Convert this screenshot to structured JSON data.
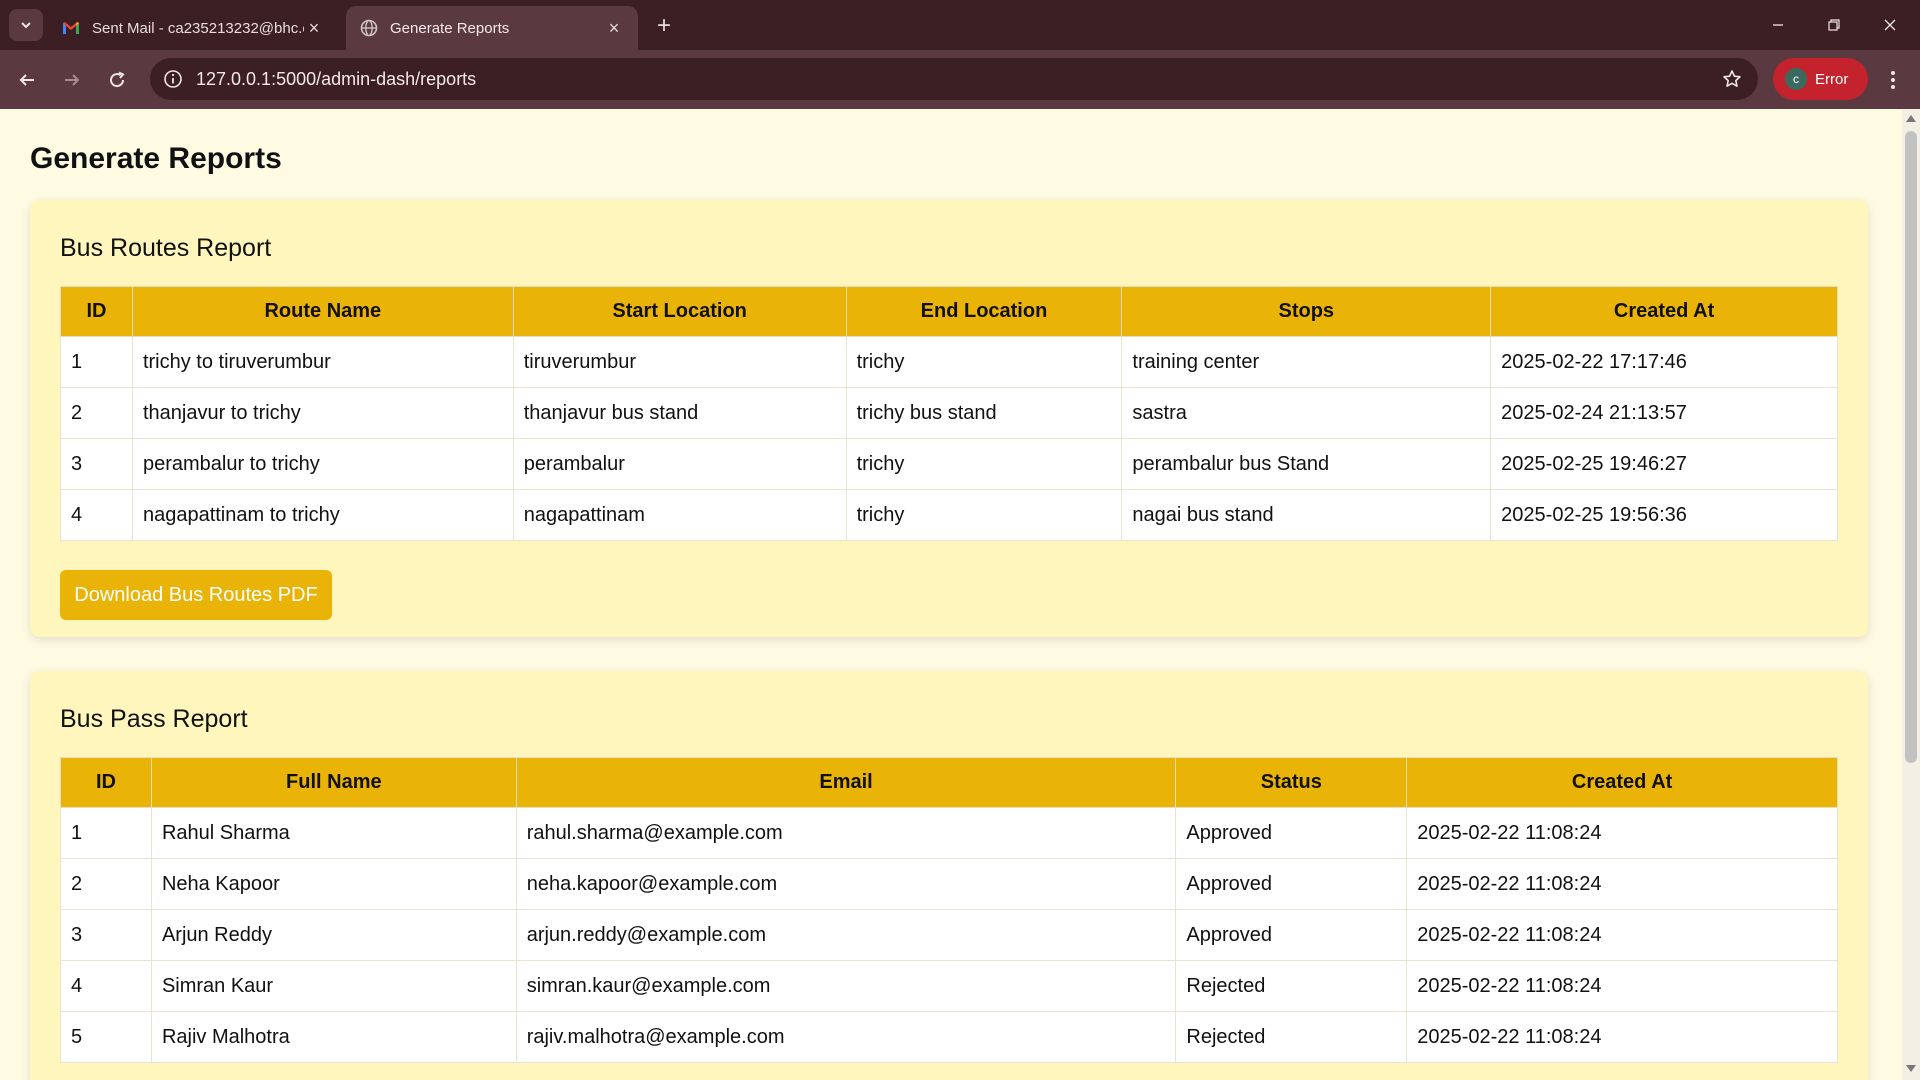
{
  "browser": {
    "tabs": [
      {
        "title": "Sent Mail - ca235213232@bhc.e",
        "favicon": "gmail-icon",
        "active": false
      },
      {
        "title": "Generate Reports",
        "favicon": "globe-icon",
        "active": true
      }
    ],
    "url": "127.0.0.1:5000/admin-dash/reports",
    "profile": {
      "initial": "c",
      "label": "Error",
      "color": "#c4232d"
    }
  },
  "page": {
    "title": "Generate Reports",
    "routes_report": {
      "heading": "Bus Routes Report",
      "columns": [
        "ID",
        "Route Name",
        "Start Location",
        "End Location",
        "Stops",
        "Created At"
      ],
      "rows": [
        [
          "1",
          "trichy to tiruverumbur",
          "tiruverumbur",
          "trichy",
          "training center",
          "2025-02-22 17:17:46"
        ],
        [
          "2",
          "thanjavur to trichy",
          "thanjavur bus stand",
          "trichy bus stand",
          "sastra",
          "2025-02-24 21:13:57"
        ],
        [
          "3",
          "perambalur to trichy",
          "perambalur",
          "trichy",
          "perambalur bus Stand",
          "2025-02-25 19:46:27"
        ],
        [
          "4",
          "nagapattinam to trichy",
          "nagapattinam",
          "trichy",
          "nagai bus stand",
          "2025-02-25 19:56:36"
        ]
      ],
      "download_label": "Download Bus Routes PDF"
    },
    "pass_report": {
      "heading": "Bus Pass Report",
      "columns": [
        "ID",
        "Full Name",
        "Email",
        "Status",
        "Created At"
      ],
      "rows": [
        [
          "1",
          "Rahul Sharma",
          "rahul.sharma@example.com",
          "Approved",
          "2025-02-22 11:08:24"
        ],
        [
          "2",
          "Neha Kapoor",
          "neha.kapoor@example.com",
          "Approved",
          "2025-02-22 11:08:24"
        ],
        [
          "3",
          "Arjun Reddy",
          "arjun.reddy@example.com",
          "Approved",
          "2025-02-22 11:08:24"
        ],
        [
          "4",
          "Simran Kaur",
          "simran.kaur@example.com",
          "Rejected",
          "2025-02-22 11:08:24"
        ],
        [
          "5",
          "Rajiv Malhotra",
          "rajiv.malhotra@example.com",
          "Rejected",
          "2025-02-22 11:08:24"
        ]
      ]
    }
  },
  "colors": {
    "accent": "#eab308",
    "page_background": "#fffbe3",
    "card_background": "#fff6bd",
    "chrome_dark": "#3b1f24",
    "chrome_light": "#5a3a40"
  }
}
